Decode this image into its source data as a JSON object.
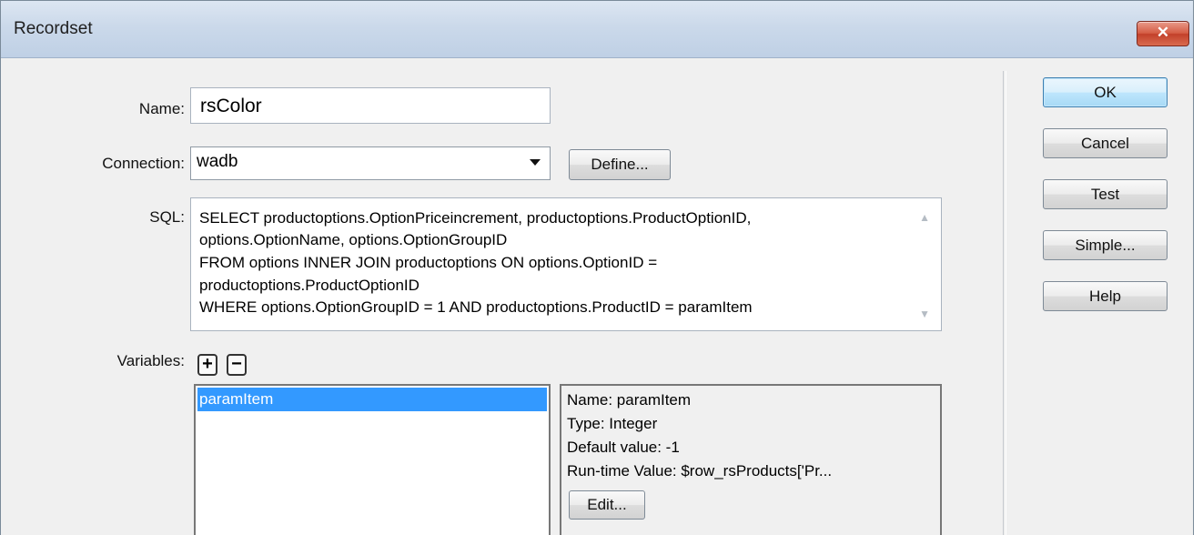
{
  "window": {
    "title": "Recordset",
    "close_glyph": "✕"
  },
  "name_field": {
    "label": "Name:",
    "value": "rsColor"
  },
  "connection": {
    "label": "Connection:",
    "value": "wadb",
    "define_label": "Define..."
  },
  "sql": {
    "label": "SQL:",
    "lines": [
      "SELECT productoptions.OptionPriceincrement, productoptions.ProductOptionID,",
      "options.OptionName, options.OptionGroupID",
      "FROM options INNER JOIN productoptions ON options.OptionID =",
      "productoptions.ProductOptionID",
      "WHERE options.OptionGroupID = 1  AND productoptions.ProductID = paramItem"
    ]
  },
  "variables": {
    "label": "Variables:",
    "add_glyph": "+",
    "remove_glyph": "−",
    "items": [
      "paramItem"
    ],
    "detail": {
      "name": "Name: paramItem",
      "type": "Type: Integer",
      "default": "Default value: -1",
      "runtime": "Run-time Value: $row_rsProducts['Pr...",
      "edit_label": "Edit..."
    }
  },
  "side_buttons": {
    "ok": "OK",
    "cancel": "Cancel",
    "test": "Test",
    "simple": "Simple...",
    "help": "Help"
  },
  "colors": {
    "selection": "#3399ff",
    "close_button": "#c94a33",
    "default_button": "#bee6fd"
  }
}
